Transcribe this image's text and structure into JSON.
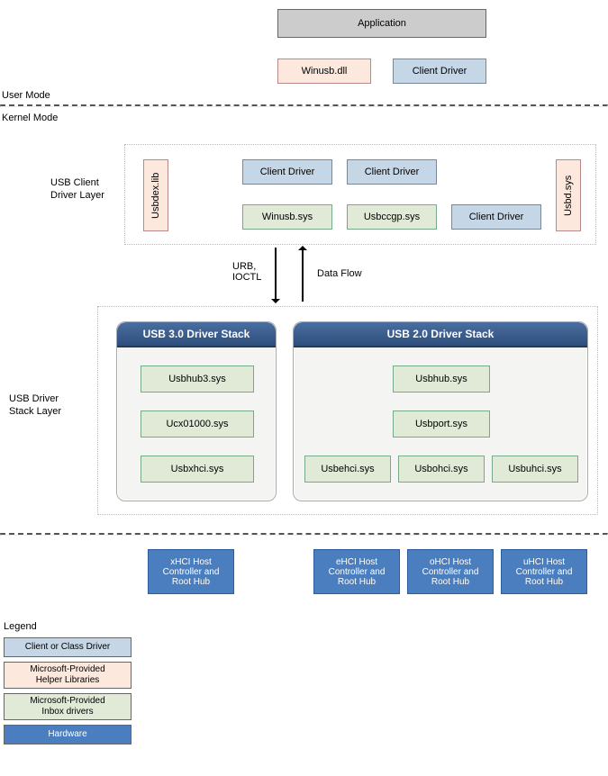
{
  "userModeLabel": "User Mode",
  "kernelModeLabel": "Kernel Mode",
  "application": "Application",
  "winusbDll": "Winusb.dll",
  "clientDriverTop": "Client Driver",
  "clientLayer": {
    "label": "USB Client\nDriver Layer",
    "usbdexLib": "Usbdex.lib",
    "clientDriver1": "Client Driver",
    "clientDriver2": "Client Driver",
    "winusbSys": "Winusb.sys",
    "usbccgpSys": "Usbccgp.sys",
    "clientDriver3": "Client Driver",
    "usbdSys": "Usbd.sys"
  },
  "flow": {
    "urbIoctl": "URB,\nIOCTL",
    "dataFlow": "Data Flow"
  },
  "stackLayerLabel": "USB Driver\nStack Layer",
  "usb30": {
    "title": "USB 3.0 Driver Stack",
    "usbhub3": "Usbhub3.sys",
    "ucx01000": "Ucx01000.sys",
    "usbxhci": "Usbxhci.sys"
  },
  "usb20": {
    "title": "USB 2.0 Driver Stack",
    "usbhub": "Usbhub.sys",
    "usbport": "Usbport.sys",
    "usbehci": "Usbehci.sys",
    "usbohci": "Usbohci.sys",
    "usbuhci": "Usbuhci.sys"
  },
  "controllers": {
    "xhci": "xHCI Host\nController and\nRoot Hub",
    "ehci": "eHCI Host\nController and\nRoot Hub",
    "ohci": "oHCI Host\nController and\nRoot Hub",
    "uhci": "uHCI Host\nController and\nRoot Hub"
  },
  "legend": {
    "title": "Legend",
    "client": "Client or Class Driver",
    "helper": "Microsoft-Provided\nHelper Libraries",
    "inbox": "Microsoft-Provided\nInbox drivers",
    "hardware": "Hardware"
  },
  "colors": {
    "gray": "#cccccc",
    "peach": "#fce8dd",
    "blueLight": "#c5d6e6",
    "greenLight": "#e1ead7",
    "blueSolid": "#4a7ebf"
  }
}
